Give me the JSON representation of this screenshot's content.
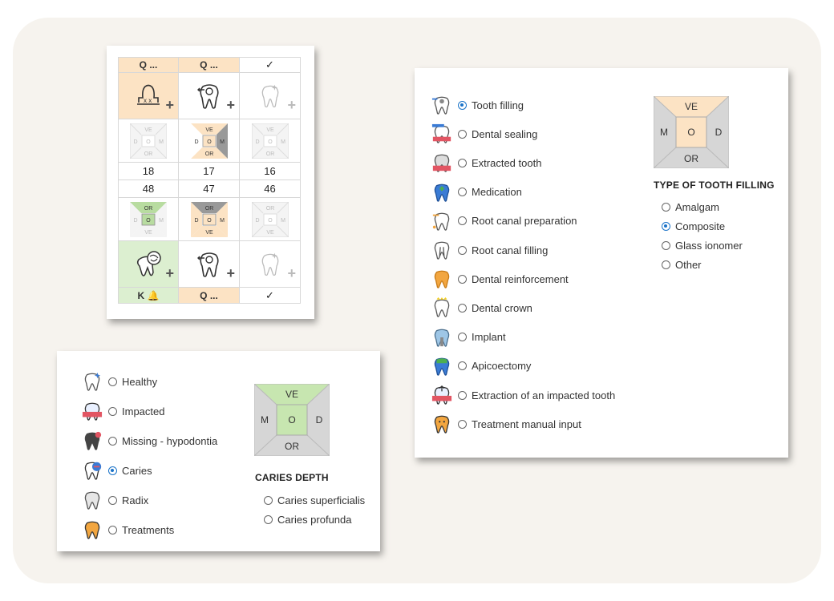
{
  "chart": {
    "top_row": [
      {
        "label": "Q ...",
        "style": "orange"
      },
      {
        "label": "Q ...",
        "style": "orange"
      },
      {
        "label": "✓",
        "style": "plain"
      }
    ],
    "upper_numbers": [
      "18",
      "17",
      "16"
    ],
    "lower_numbers": [
      "48",
      "47",
      "46"
    ],
    "surface_labels": {
      "ve": "VE",
      "or": "OR",
      "d": "D",
      "o": "O",
      "m": "M"
    },
    "bottom_row": [
      {
        "label": "K 🔔",
        "style": "green"
      },
      {
        "label": "Q ...",
        "style": "orange"
      },
      {
        "label": "✓",
        "style": "plain"
      }
    ]
  },
  "status_panel": {
    "options": [
      {
        "label": "Healthy",
        "icon": "healthy-tooth-icon",
        "selected": false
      },
      {
        "label": "Impacted",
        "icon": "impacted-tooth-icon",
        "selected": false
      },
      {
        "label": "Missing - hypodontia",
        "icon": "missing-tooth-icon",
        "selected": false
      },
      {
        "label": "Caries",
        "icon": "caries-tooth-icon",
        "selected": true
      },
      {
        "label": "Radix",
        "icon": "radix-icon",
        "selected": false
      },
      {
        "label": "Treatments",
        "icon": "treatment-tooth-icon",
        "selected": false
      }
    ],
    "diagram": {
      "top": "VE",
      "left": "M",
      "center": "O",
      "right": "D",
      "bottom": "OR"
    },
    "section_title": "CARIES DEPTH",
    "depth_options": [
      {
        "label": "Caries superficialis",
        "selected": false
      },
      {
        "label": "Caries profunda",
        "selected": false
      }
    ]
  },
  "treatment_panel": {
    "options": [
      {
        "label": "Tooth filling",
        "icon": "tooth-filling-icon",
        "selected": true
      },
      {
        "label": "Dental sealing",
        "icon": "dental-sealing-icon",
        "selected": false
      },
      {
        "label": "Extracted tooth",
        "icon": "extracted-tooth-icon",
        "selected": false
      },
      {
        "label": "Medication",
        "icon": "medication-icon",
        "selected": false
      },
      {
        "label": "Root canal preparation",
        "icon": "root-canal-prep-icon",
        "selected": false
      },
      {
        "label": "Root canal filling",
        "icon": "root-canal-filling-icon",
        "selected": false
      },
      {
        "label": "Dental reinforcement",
        "icon": "dental-reinforcement-icon",
        "selected": false
      },
      {
        "label": "Dental crown",
        "icon": "dental-crown-icon",
        "selected": false
      },
      {
        "label": "Implant",
        "icon": "implant-icon",
        "selected": false
      },
      {
        "label": "Apicoectomy",
        "icon": "apicoectomy-icon",
        "selected": false
      },
      {
        "label": "Extraction of an impacted tooth",
        "icon": "impacted-extraction-icon",
        "selected": false
      },
      {
        "label": "Treatment manual input",
        "icon": "manual-input-icon",
        "selected": false
      }
    ],
    "diagram": {
      "top": "VE",
      "left": "M",
      "center": "O",
      "right": "D",
      "bottom": "OR"
    },
    "section_title": "TYPE OF TOOTH FILLING",
    "filling_options": [
      {
        "label": "Amalgam",
        "selected": false
      },
      {
        "label": "Composite",
        "selected": true
      },
      {
        "label": "Glass ionomer",
        "selected": false
      },
      {
        "label": "Other",
        "selected": false
      }
    ]
  },
  "colors": {
    "orange_fill": "#fce3c4",
    "green_fill": "#dcefd0",
    "grey_fill": "#d6d6d6",
    "radio_selected": "#1a73c8"
  }
}
